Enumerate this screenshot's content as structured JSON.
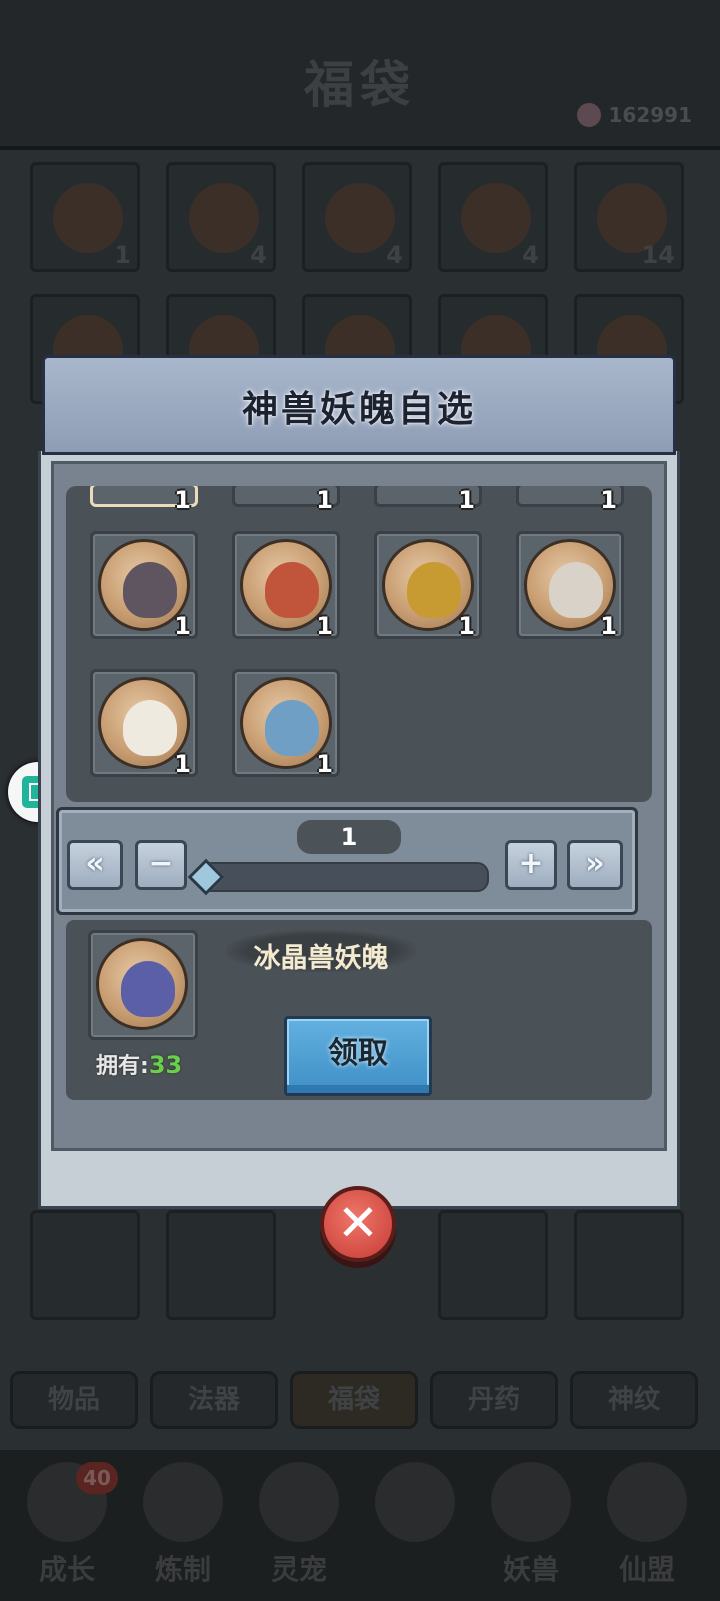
{
  "background": {
    "title": "福袋",
    "currency": "162991",
    "bag_slots": [
      {
        "count": "1"
      },
      {
        "count": "4"
      },
      {
        "count": "4"
      },
      {
        "count": "4"
      },
      {
        "count": "14"
      },
      {
        "count": ""
      },
      {
        "count": ""
      },
      {
        "count": ""
      },
      {
        "count": ""
      },
      {
        "count": ""
      }
    ],
    "tabs": [
      "物品",
      "法器",
      "福袋",
      "丹药",
      "神纹"
    ],
    "active_tab": "福袋",
    "nav": [
      {
        "label": "成长",
        "badge": "40"
      },
      {
        "label": "炼制",
        "badge": ""
      },
      {
        "label": "灵宠",
        "badge": ""
      },
      {
        "label": "",
        "badge": ""
      },
      {
        "label": "妖兽",
        "badge": ""
      },
      {
        "label": "仙盟",
        "badge": ""
      }
    ]
  },
  "dialog": {
    "title": "神兽妖魄自选",
    "items": [
      {
        "count": "1",
        "icon": "partial-beast-icon"
      },
      {
        "count": "1",
        "icon": "partial-beast-icon"
      },
      {
        "count": "1",
        "icon": "partial-beast-icon"
      },
      {
        "count": "1",
        "icon": "partial-beast-icon"
      },
      {
        "count": "1",
        "icon": "dark-beast-icon",
        "color": "#5e5560"
      },
      {
        "count": "1",
        "icon": "fire-dragon-icon",
        "color": "#c0553b"
      },
      {
        "count": "1",
        "icon": "golden-eagle-icon",
        "color": "#c89a32"
      },
      {
        "count": "1",
        "icon": "crane-icon",
        "color": "#d8d2c8"
      },
      {
        "count": "1",
        "icon": "panda-icon",
        "color": "#efeae0"
      },
      {
        "count": "1",
        "icon": "ice-whale-icon",
        "color": "#6f9fc4"
      }
    ],
    "quantity": "1",
    "quantity_fraction": 0.0,
    "selected": {
      "name": "冰晶兽妖魄",
      "icon": "ice-crystal-beast-icon",
      "color": "#5a5fa8",
      "owned_label": "拥有:",
      "owned_count": "33"
    },
    "claim_label": "领取",
    "buttons": {
      "min": "«",
      "minus": "−",
      "plus": "+",
      "max": "»",
      "close": "✕"
    }
  }
}
